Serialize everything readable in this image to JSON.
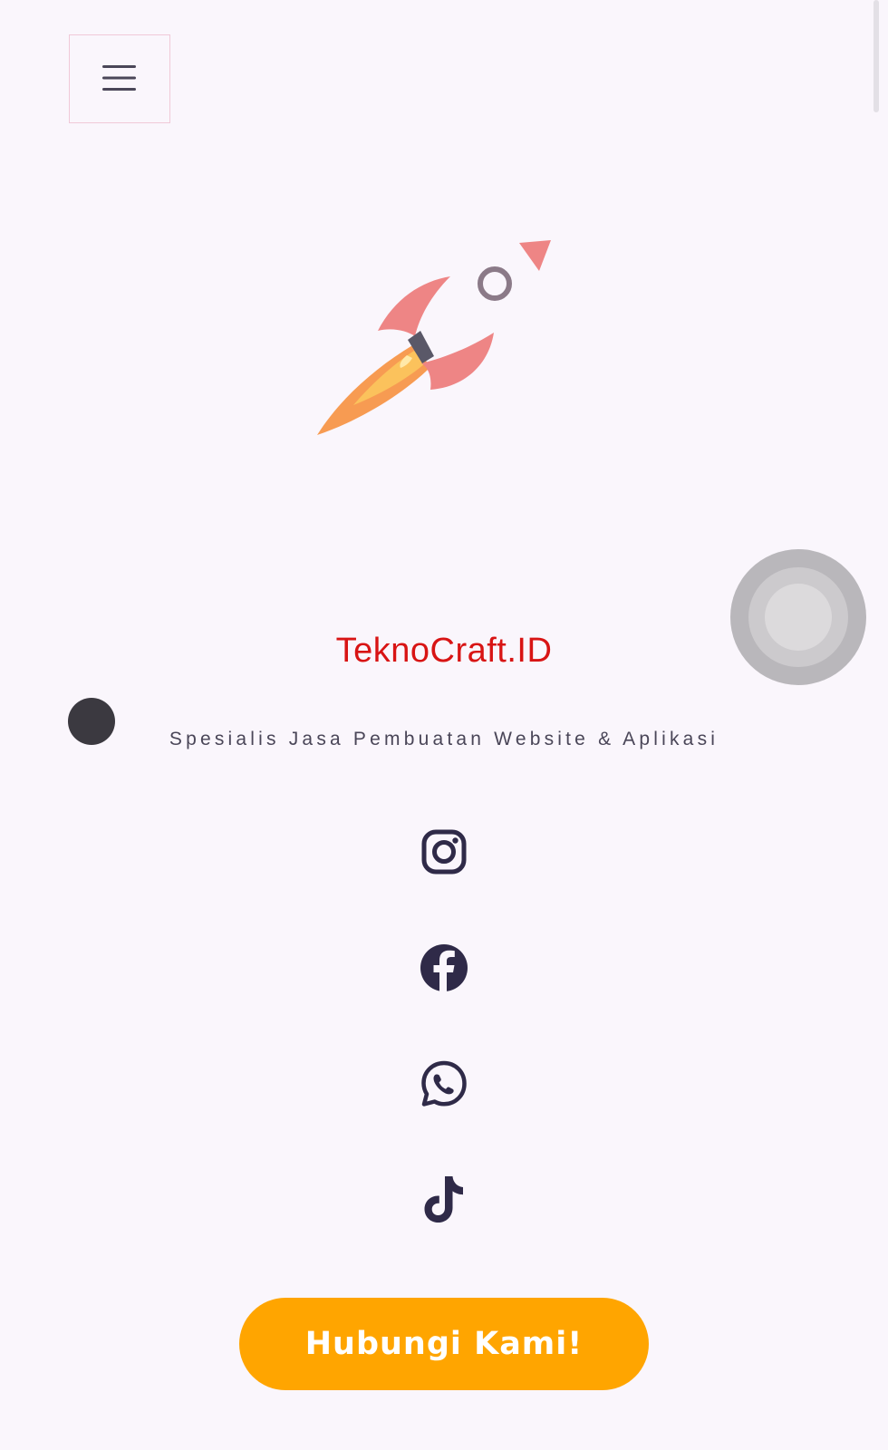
{
  "header": {
    "menu_icon": "hamburger-menu-icon"
  },
  "hero": {
    "logo_icon": "rocket-icon",
    "title": "TeknoCraft.ID",
    "tagline": "Spesialis Jasa Pembuatan Website & Aplikasi"
  },
  "social": [
    {
      "name": "instagram",
      "icon": "instagram-icon"
    },
    {
      "name": "facebook",
      "icon": "facebook-icon"
    },
    {
      "name": "whatsapp",
      "icon": "whatsapp-icon"
    },
    {
      "name": "tiktok",
      "icon": "tiktok-icon"
    }
  ],
  "cta": {
    "label": "Hubungi Kami!"
  },
  "colors": {
    "background": "#faf6fc",
    "title": "#d81414",
    "accent": "#ffa500",
    "icon": "#2f2a48",
    "rocket_fin": "#ee8585"
  }
}
